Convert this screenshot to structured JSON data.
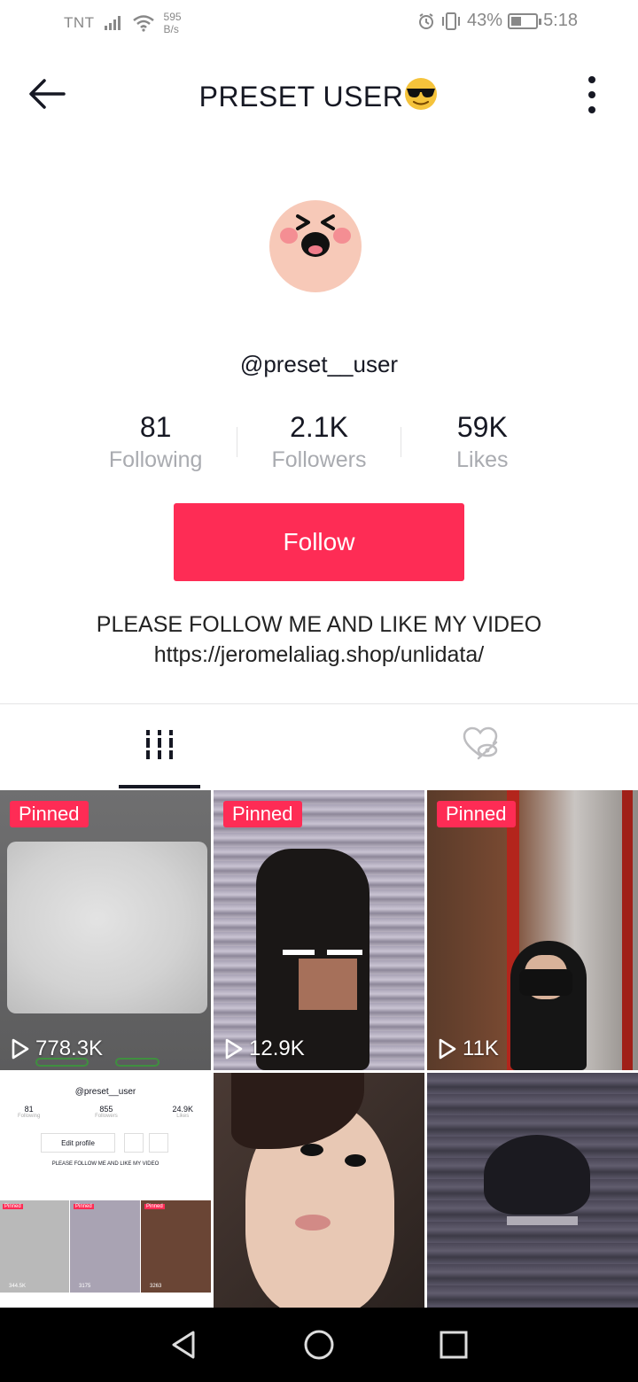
{
  "status_bar": {
    "carrier": "TNT",
    "speed_value": "595",
    "speed_unit": "B/s",
    "battery": "43%",
    "battery_level": 0.43,
    "time": "5:18"
  },
  "header": {
    "title": "PRESET USER",
    "title_emoji": "smiling-face-with-sunglasses-emoji"
  },
  "profile": {
    "avatar_icon": "squinting-face-avatar",
    "username": "@preset__user",
    "stats": [
      {
        "value": "81",
        "label": "Following"
      },
      {
        "value": "2.1K",
        "label": "Followers"
      },
      {
        "value": "59K",
        "label": "Likes"
      }
    ],
    "follow_label": "Follow",
    "bio_line1": "PLEASE FOLLOW ME AND LIKE MY VIDEO",
    "bio_line2": "https://jeromelaliag.shop/unlidata/"
  },
  "tabs": {
    "videos_icon": "grid-icon",
    "liked_icon": "hidden-heart-icon"
  },
  "videos": [
    {
      "pinned": "Pinned",
      "plays": "778.3K"
    },
    {
      "pinned": "Pinned",
      "plays": "12.9K"
    },
    {
      "pinned": "Pinned",
      "plays": "11K"
    },
    {
      "pinned": "",
      "plays": ""
    },
    {
      "pinned": "",
      "plays": ""
    },
    {
      "pinned": "",
      "plays": ""
    }
  ],
  "thumb_screenshot": {
    "username": "@preset__user",
    "stats": [
      {
        "value": "81",
        "label": "Following"
      },
      {
        "value": "855",
        "label": "Followers"
      },
      {
        "value": "24.9K",
        "label": "Likes"
      }
    ],
    "edit_label": "Edit profile",
    "bio": "PLEASE FOLLOW ME AND LIKE MY VIDEO",
    "pinned": "Pinned",
    "plays": [
      "344.5K",
      "3175",
      "3263"
    ]
  },
  "colors": {
    "accent": "#fe2c55",
    "text": "#161823",
    "muted": "#a9abb0"
  }
}
